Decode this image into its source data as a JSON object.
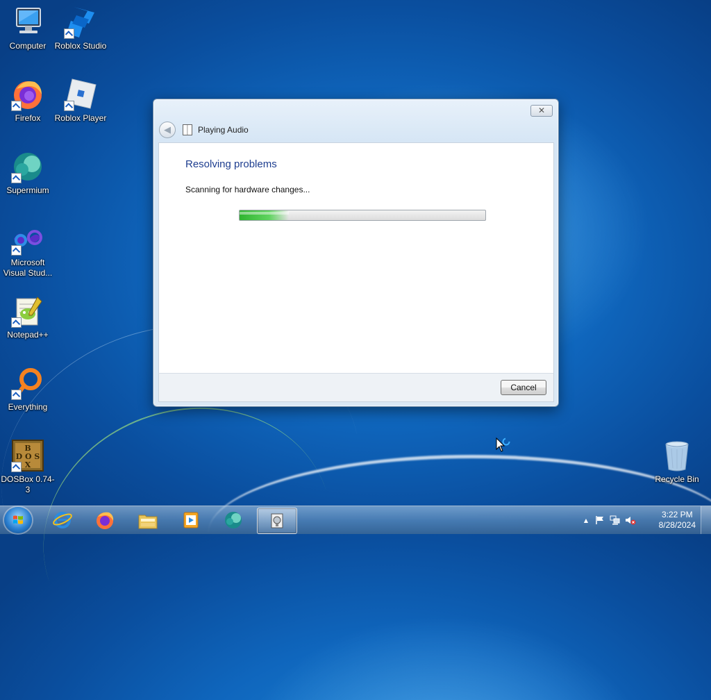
{
  "desktop": {
    "icons": [
      {
        "label": "Computer",
        "icon": "computer-icon"
      },
      {
        "label": "Roblox Studio",
        "icon": "roblox-studio-icon"
      },
      {
        "label": "Firefox",
        "icon": "firefox-icon"
      },
      {
        "label": "Roblox Player",
        "icon": "roblox-player-icon"
      },
      {
        "label": "Supermium",
        "icon": "supermium-icon"
      },
      {
        "label": "Microsoft Visual Stud...",
        "icon": "visual-studio-icon"
      },
      {
        "label": "Notepad++",
        "icon": "notepadpp-icon"
      },
      {
        "label": "Everything",
        "icon": "everything-icon"
      },
      {
        "label": "DOSBox 0.74-3",
        "icon": "dosbox-icon",
        "glyph_text": "BOX DOS BOX"
      },
      {
        "label": "Recycle Bin",
        "icon": "recycle-bin-icon"
      }
    ]
  },
  "dialog": {
    "title": "Playing Audio",
    "close_glyph": "✕",
    "heading": "Resolving problems",
    "status": "Scanning for hardware changes...",
    "progress_fraction": 0.2,
    "cancel_label": "Cancel",
    "accent_color": "#1d3d8f",
    "progress_color": "#2fb52f"
  },
  "taskbar": {
    "pinned": [
      "start-orb",
      "internet-explorer-icon",
      "firefox-icon",
      "file-explorer-icon",
      "media-player-icon",
      "supermium-icon",
      "troubleshooter-icon"
    ],
    "active": "troubleshooter-icon",
    "tray": {
      "show_hidden_glyph": "▲",
      "icons": [
        "action-center-flag-icon",
        "network-icon",
        "volume-muted-icon"
      ]
    },
    "clock": {
      "time": "3:22 PM",
      "date": "8/28/2024"
    }
  }
}
